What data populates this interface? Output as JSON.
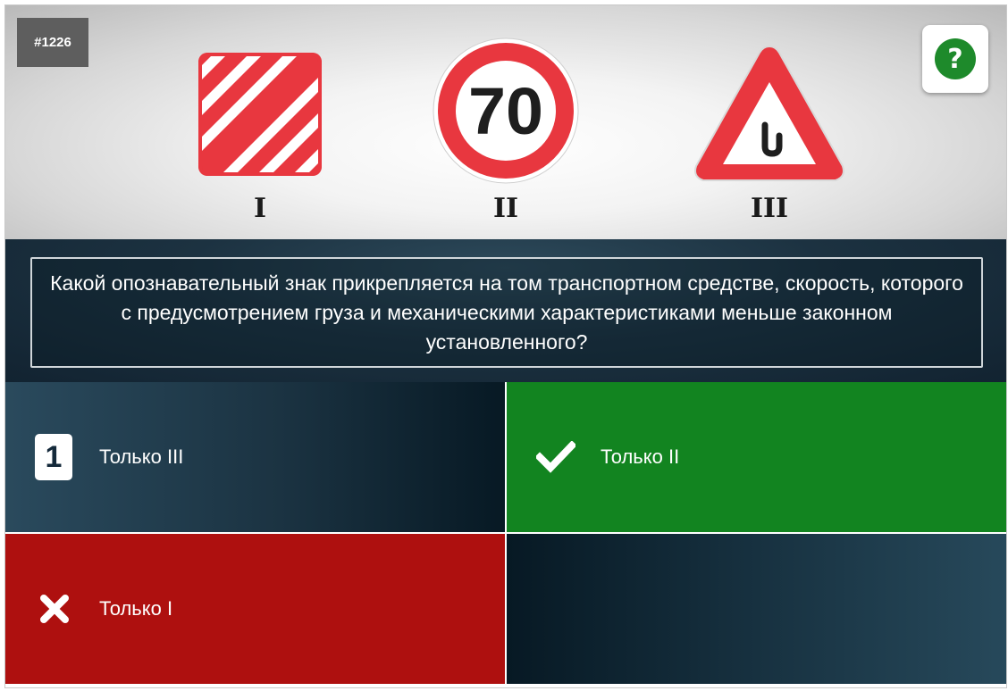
{
  "question_number": "#1226",
  "help": {
    "icon": "question-icon",
    "glyph": "?"
  },
  "signs": [
    {
      "label": "I",
      "kind": "red-white-striped-plate"
    },
    {
      "label": "II",
      "kind": "speed-limit-70",
      "value": "70"
    },
    {
      "label": "III",
      "kind": "trailer-hook-warning-triangle"
    }
  ],
  "question": "Какой опознавательный знак прикрепляется на том транспортном средстве, скорость, которого с предусмотрением груза и механическими характеристиками меньше законном установленного?",
  "answers": [
    {
      "badge": "1",
      "label": "Только III",
      "state": "default"
    },
    {
      "badge": "",
      "label": "Только II",
      "state": "correct",
      "icon": "checkmark-icon"
    },
    {
      "badge": "",
      "label": "Только I",
      "state": "wrong",
      "icon": "cross-icon"
    },
    {
      "badge": "",
      "label": "",
      "state": "empty"
    }
  ],
  "colors": {
    "correct": "#128420",
    "wrong": "#ae100f",
    "help": "#1e8a2b",
    "sign_red": "#e8373f"
  }
}
